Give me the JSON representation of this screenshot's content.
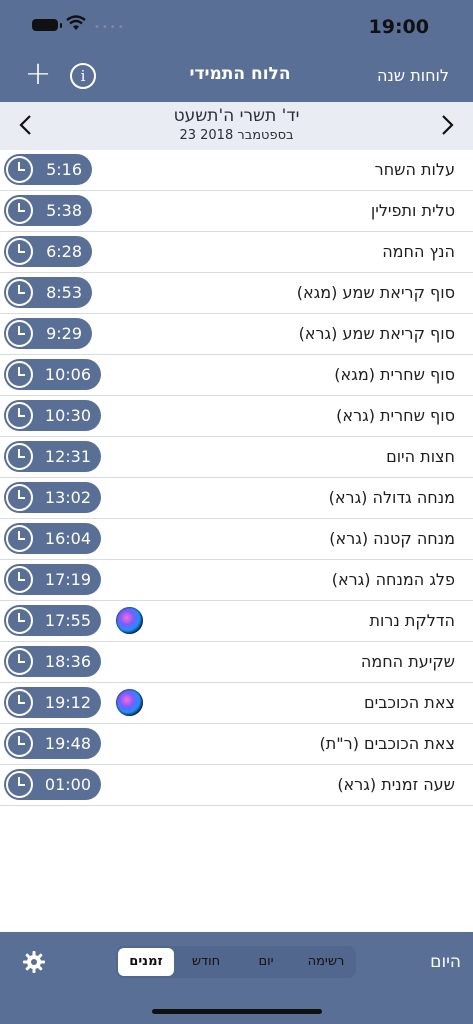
{
  "status": {
    "time": "19:00"
  },
  "nav": {
    "title": "הלוח התמידי",
    "right_link": "לוחות שנה",
    "plus": "+",
    "info": "i"
  },
  "date": {
    "hebrew": "יד' תשרי ה'תשעט",
    "civil": "23 בספטמבר 2018"
  },
  "zmanim": [
    {
      "label": "עלות השחר",
      "time": "5:16",
      "siri": false
    },
    {
      "label": "טלית ותפילין",
      "time": "5:38",
      "siri": false
    },
    {
      "label": "הנץ החמה",
      "time": "6:28",
      "siri": false
    },
    {
      "label": "סוף קריאת שמע (מגא)",
      "time": "8:53",
      "siri": false
    },
    {
      "label": "סוף קריאת שמע (גרא)",
      "time": "9:29",
      "siri": false
    },
    {
      "label": "סוף שחרית (מגא)",
      "time": "10:06",
      "siri": false
    },
    {
      "label": "סוף שחרית (גרא)",
      "time": "10:30",
      "siri": false
    },
    {
      "label": "חצות היום",
      "time": "12:31",
      "siri": false
    },
    {
      "label": "מנחה גדולה (גרא)",
      "time": "13:02",
      "siri": false
    },
    {
      "label": "מנחה קטנה (גרא)",
      "time": "16:04",
      "siri": false
    },
    {
      "label": "פלג המנחה (גרא)",
      "time": "17:19",
      "siri": false
    },
    {
      "label": "הדלקת נרות",
      "time": "17:55",
      "siri": true
    },
    {
      "label": "שקיעת החמה",
      "time": "18:36",
      "siri": false
    },
    {
      "label": "צאת הכוכבים",
      "time": "19:12",
      "siri": true
    },
    {
      "label": "צאת הכוכבים (ר\"ת)",
      "time": "19:48",
      "siri": false
    },
    {
      "label": "שעה זמנית (גרא)",
      "time": "01:00",
      "siri": false
    }
  ],
  "tabbar": {
    "today": "היום",
    "segments": [
      "זמנים",
      "חודש",
      "יום",
      "רשימה"
    ],
    "active_segment": "זמנים"
  },
  "icons": {
    "gear": "gear-icon",
    "clock": "clock-icon",
    "siri": "siri-icon",
    "chevron_left": "chevron-left-icon",
    "chevron_right": "chevron-right-icon"
  },
  "colors": {
    "bar": "#5a6f96",
    "date_bar": "#e9edf3",
    "divider": "#d7dbe2"
  }
}
